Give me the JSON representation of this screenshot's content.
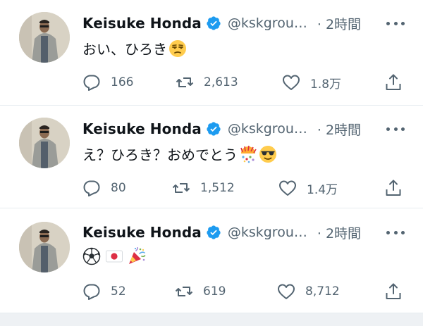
{
  "tweets": [
    {
      "name": "Keisuke Honda",
      "handle": "@kskgrou…",
      "time": "· 2時間",
      "text": "おい、ひろき",
      "emojis": [
        "unamused-face"
      ],
      "replies": "166",
      "retweets": "2,613",
      "likes": "1.8万"
    },
    {
      "name": "Keisuke Honda",
      "handle": "@kskgrou…",
      "time": "· 2時間",
      "text": "え？ひろき？おめでとう",
      "emojis": [
        "confetti-ball",
        "sunglasses-face"
      ],
      "replies": "80",
      "retweets": "1,512",
      "likes": "1.4万"
    },
    {
      "name": "Keisuke Honda",
      "handle": "@kskgrou…",
      "time": "· 2時間",
      "text": "",
      "emojis": [
        "soccer-ball",
        "japan-flag",
        "party-popper"
      ],
      "replies": "52",
      "retweets": "619",
      "likes": "8,712"
    }
  ],
  "colors": {
    "verified": "#1d9bf0",
    "secondary_text": "#536471",
    "divider": "#e6ecf0"
  }
}
